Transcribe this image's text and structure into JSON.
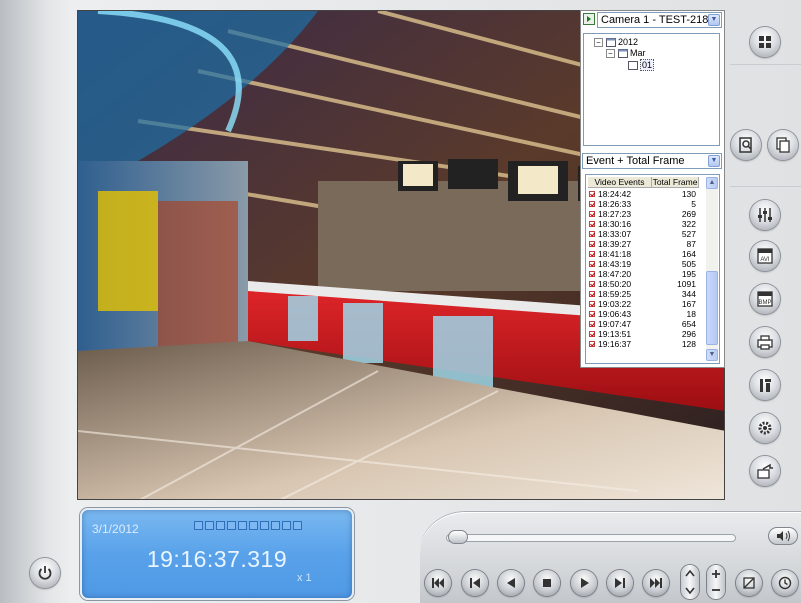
{
  "camera": {
    "selected": "Camera 1 - TEST-218"
  },
  "tree": {
    "year": "2012",
    "month": "Mar",
    "day": "01"
  },
  "filter": {
    "selected": "Event + Total Frame"
  },
  "events": {
    "columns": [
      "Video Events",
      "Total Frame"
    ],
    "rows": [
      {
        "time": "18:24:42",
        "frames": "130"
      },
      {
        "time": "18:26:33",
        "frames": "5"
      },
      {
        "time": "18:27:23",
        "frames": "269"
      },
      {
        "time": "18:30:16",
        "frames": "322"
      },
      {
        "time": "18:33:07",
        "frames": "527"
      },
      {
        "time": "18:39:27",
        "frames": "87"
      },
      {
        "time": "18:41:18",
        "frames": "164"
      },
      {
        "time": "18:43:19",
        "frames": "505"
      },
      {
        "time": "18:47:20",
        "frames": "195"
      },
      {
        "time": "18:50:20",
        "frames": "1091"
      },
      {
        "time": "18:59:25",
        "frames": "344"
      },
      {
        "time": "19:03:22",
        "frames": "167"
      },
      {
        "time": "19:06:43",
        "frames": "18"
      },
      {
        "time": "19:07:47",
        "frames": "654"
      },
      {
        "time": "19:13:51",
        "frames": "296"
      },
      {
        "time": "19:16:37",
        "frames": "128"
      }
    ]
  },
  "status": {
    "date": "3/1/2012",
    "time": "19:16:37.319",
    "speed": "x 1"
  },
  "colors": {
    "lcd": "#59a2ea",
    "event_check": "#cc0000"
  }
}
